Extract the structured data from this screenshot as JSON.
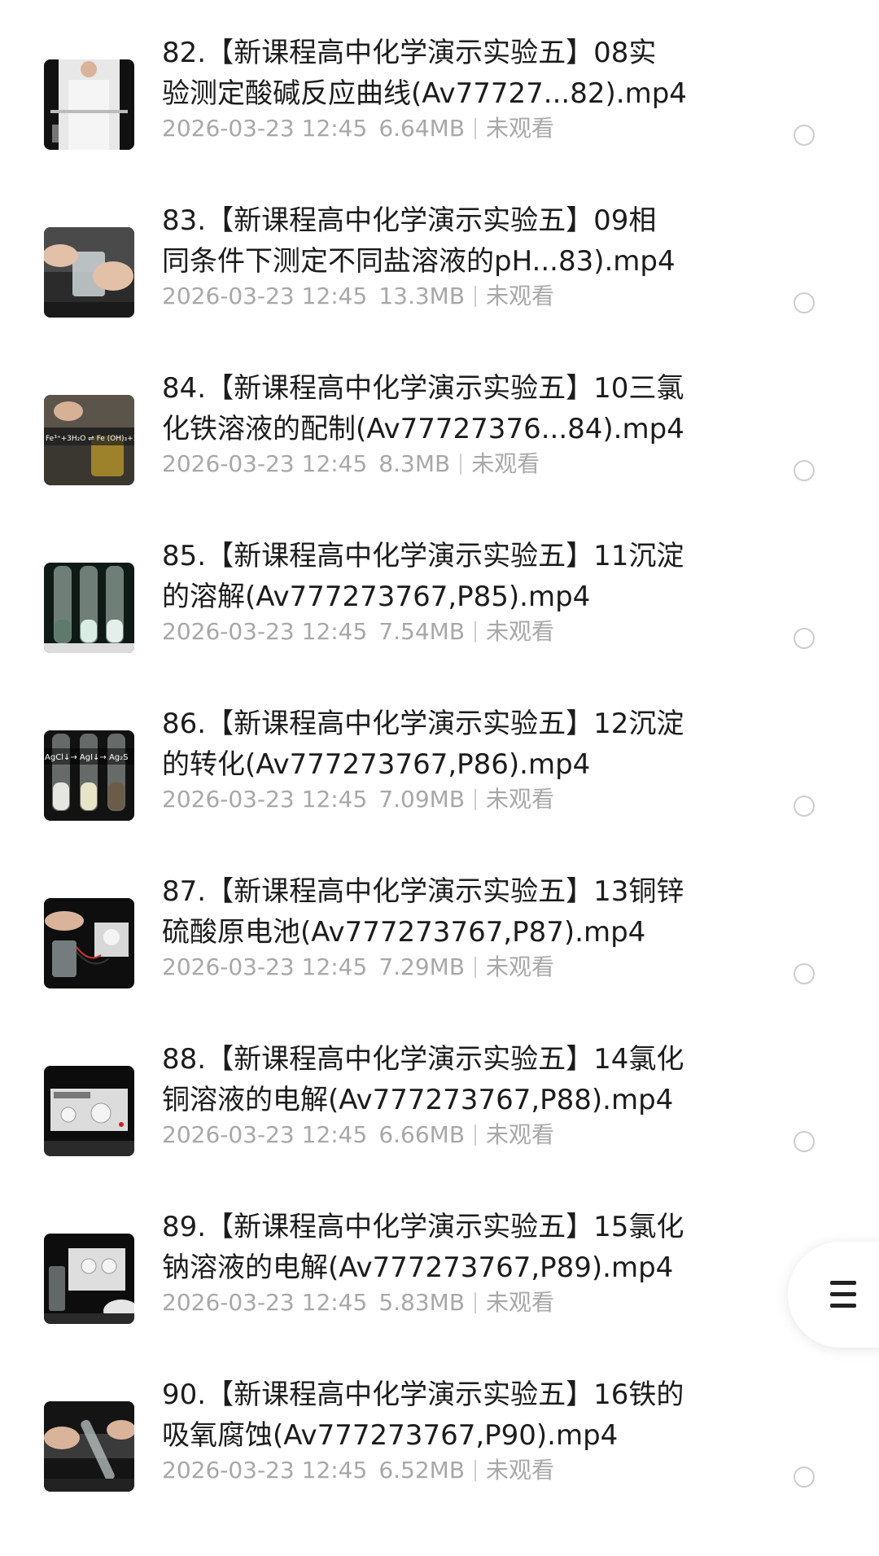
{
  "files": [
    {
      "title_line1": "82.【新课程高中化学演示实验五】08实",
      "title_line2": "验测定酸碱反应曲线(Av77727...82).mp4",
      "date": "2026-03-23 12:45",
      "size": "6.64MB",
      "status": "未观看"
    },
    {
      "title_line1": "83.【新课程高中化学演示实验五】09相",
      "title_line2": "同条件下测定不同盐溶液的pH...83).mp4",
      "date": "2026-03-23 12:45",
      "size": "13.3MB",
      "status": "未观看"
    },
    {
      "title_line1": "84.【新课程高中化学演示实验五】10三氯",
      "title_line2": "化铁溶液的配制(Av77727376...84).mp4",
      "date": "2026-03-23 12:45",
      "size": "8.3MB",
      "status": "未观看",
      "thumb_text": "Fe³⁺+3H₂O ⇌ Fe (OH)₃+3H"
    },
    {
      "title_line1": "85.【新课程高中化学演示实验五】11沉淀",
      "title_line2": "的溶解(Av777273767,P85).mp4",
      "date": "2026-03-23 12:45",
      "size": "7.54MB",
      "status": "未观看"
    },
    {
      "title_line1": "86.【新课程高中化学演示实验五】12沉淀",
      "title_line2": "的转化(Av777273767,P86).mp4",
      "date": "2026-03-23 12:45",
      "size": "7.09MB",
      "status": "未观看",
      "thumb_text": "AgCl↓→ AgI↓→ Ag₂S"
    },
    {
      "title_line1": "87.【新课程高中化学演示实验五】13铜锌",
      "title_line2": "硫酸原电池(Av777273767,P87).mp4",
      "date": "2026-03-23 12:45",
      "size": "7.29MB",
      "status": "未观看"
    },
    {
      "title_line1": "88.【新课程高中化学演示实验五】14氯化",
      "title_line2": "铜溶液的电解(Av777273767,P88).mp4",
      "date": "2026-03-23 12:45",
      "size": "6.66MB",
      "status": "未观看"
    },
    {
      "title_line1": "89.【新课程高中化学演示实验五】15氯化",
      "title_line2": "钠溶液的电解(Av777273767,P89).mp4",
      "date": "2026-03-23 12:45",
      "size": "5.83MB",
      "status": "未观看"
    },
    {
      "title_line1": "90.【新课程高中化学演示实验五】16铁的",
      "title_line2": "吸氧腐蚀(Av777273767,P90).mp4",
      "date": "2026-03-23 12:45",
      "size": "6.52MB",
      "status": "未观看"
    }
  ],
  "fab": {
    "icon": "menu-icon"
  },
  "colors": {
    "title": "#1c1c1c",
    "meta": "#a8a8a8",
    "radio_border": "#cdcdcd",
    "background": "#ffffff"
  }
}
